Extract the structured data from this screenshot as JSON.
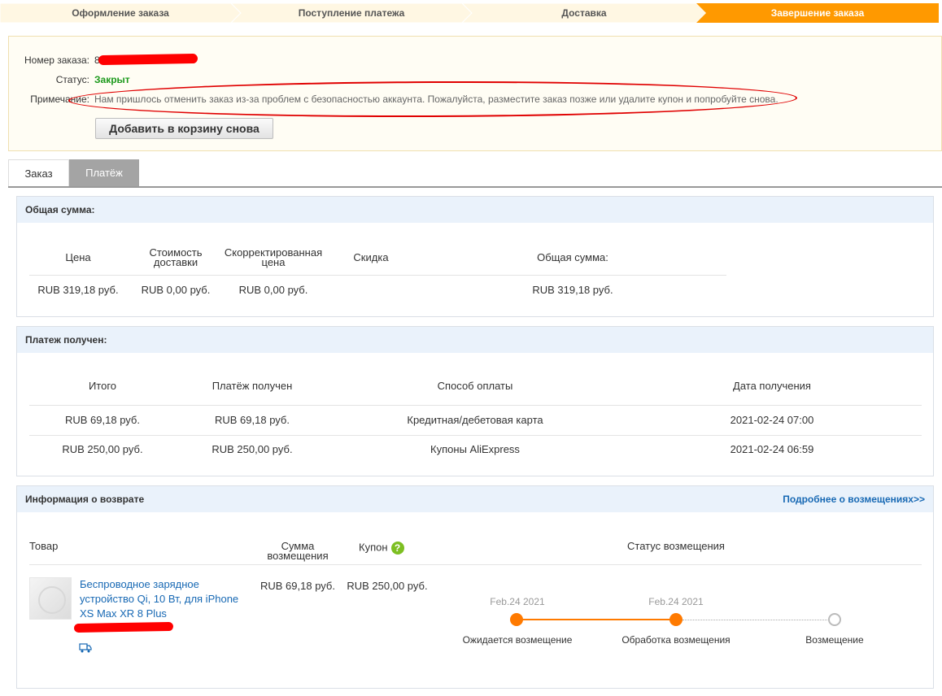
{
  "steps": [
    {
      "label": "Оформление заказа",
      "active": false
    },
    {
      "label": "Поступление платежа",
      "active": false
    },
    {
      "label": "Доставка",
      "active": false
    },
    {
      "label": "Завершение заказа",
      "active": true
    }
  ],
  "colors": {
    "step_bg": "#fff7e3",
    "step_active": "#ff9900",
    "status": "#1d9a1d",
    "link": "#1869b4",
    "accent": "#ff7a00"
  },
  "order_info": {
    "number_label": "Номер заказа:",
    "number_value": "8",
    "status_label": "Статус:",
    "status_value": "Закрыт",
    "note_label": "Примечание:",
    "note_value": "Нам пришлось отменить заказ из-за проблем с безопасностью аккаунта. Пожалуйста, разместите заказ позже или удалите купон и попробуйте снова.",
    "readd_button": "Добавить в корзину снова"
  },
  "tabs": {
    "order": "Заказ",
    "payment": "Платёж"
  },
  "total": {
    "title": "Общая сумма:",
    "headers": {
      "price": "Цена",
      "shipping": "Стоимость доставки",
      "adjusted": "Скорректированная цена",
      "discount": "Скидка",
      "total": "Общая сумма:"
    },
    "values": {
      "price": "RUB 319,18 руб.",
      "shipping": "RUB 0,00 руб.",
      "adjusted": "RUB 0,00 руб.",
      "discount": "",
      "total": "RUB 319,18 руб."
    }
  },
  "payment": {
    "title": "Платеж получен:",
    "headers": {
      "subtotal": "Итого",
      "received": "Платёж получен",
      "method": "Способ оплаты",
      "date": "Дата получения"
    },
    "rows": [
      {
        "subtotal": "RUB 69,18 руб.",
        "received": "RUB 69,18 руб.",
        "method": "Кредитная/дебетовая карта",
        "date": "2021-02-24 07:00"
      },
      {
        "subtotal": "RUB 250,00 руб.",
        "received": "RUB 250,00 руб.",
        "method": "Купоны AliExpress",
        "date": "2021-02-24 06:59"
      }
    ]
  },
  "refund": {
    "title": "Информация о возврате",
    "more_link": "Подробнее о возмещениях>>",
    "headers": {
      "product": "Товар",
      "amount": "Сумма возмещения",
      "coupon": "Купон",
      "status": "Статус возмещения"
    },
    "help_icon": "question-icon",
    "product_name": "Беспроводное зарядное устройство Qi, 10 Вт, для iPhone XS Max XR 8 Plus",
    "amount": "RUB 69,18 руб.",
    "coupon": "RUB 250,00 руб.",
    "timeline": [
      {
        "date": "Feb.24 2021",
        "label": "Ожидается возмещение",
        "done": true
      },
      {
        "date": "Feb.24 2021",
        "label": "Обработка возмещения",
        "done": true
      },
      {
        "date": "",
        "label": "Возмещение",
        "done": false
      }
    ]
  }
}
